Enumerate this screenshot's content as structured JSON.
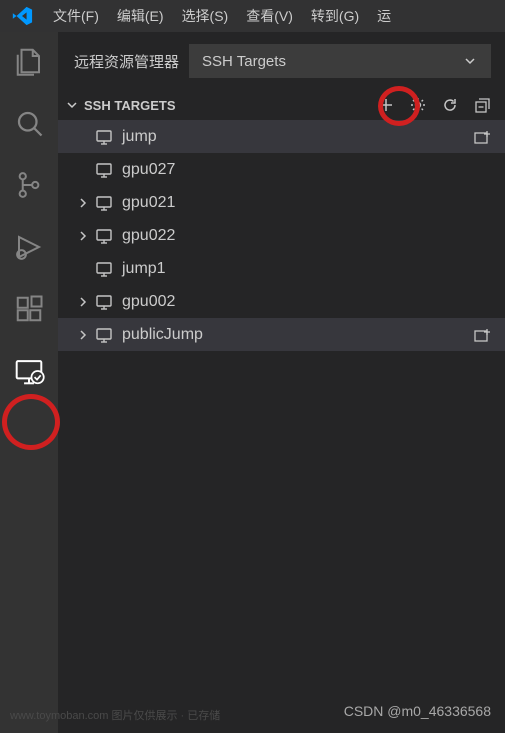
{
  "menu": {
    "items": [
      "文件(F)",
      "编辑(E)",
      "选择(S)",
      "查看(V)",
      "转到(G)",
      "运"
    ]
  },
  "sidebar": {
    "title": "远程资源管理器",
    "dropdown": {
      "selected": "SSH Targets"
    },
    "section": {
      "label": "SSH TARGETS",
      "actions": {
        "add": "add-icon",
        "configure": "gear-icon",
        "refresh": "refresh-icon",
        "collapse": "collapse-all-icon"
      }
    }
  },
  "tree": [
    {
      "label": "jump",
      "expandable": false,
      "selected": true,
      "action": true
    },
    {
      "label": "gpu027",
      "expandable": false,
      "selected": false,
      "action": false
    },
    {
      "label": "gpu021",
      "expandable": true,
      "selected": false,
      "action": false
    },
    {
      "label": "gpu022",
      "expandable": true,
      "selected": false,
      "action": false
    },
    {
      "label": "jump1",
      "expandable": false,
      "selected": false,
      "action": false
    },
    {
      "label": "gpu002",
      "expandable": true,
      "selected": false,
      "action": false
    },
    {
      "label": "publicJump",
      "expandable": true,
      "selected": true,
      "action": true
    }
  ],
  "footer": {
    "watermark": "www.toymoban.com 图片仅供展示 · 已存储",
    "csdn": "CSDN @m0_46336568"
  }
}
